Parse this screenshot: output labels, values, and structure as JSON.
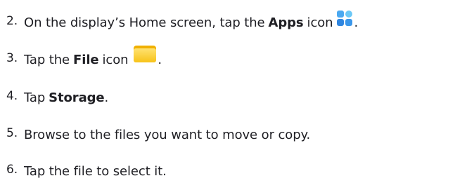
{
  "steps": [
    {
      "number": "2.",
      "before": "On the display’s Home screen, tap the",
      "bold": "Apps",
      "after": "icon",
      "icon": "apps-icon",
      "end": "."
    },
    {
      "number": "3.",
      "before": "Tap the",
      "bold": "File",
      "after": "icon",
      "icon": "folder-icon",
      "end": "."
    },
    {
      "number": "4.",
      "before": "Tap",
      "bold": "Storage",
      "end": "."
    },
    {
      "number": "5.",
      "text": "Browse to the files you want to move or copy."
    },
    {
      "number": "6.",
      "text": "Tap the file to select it."
    }
  ],
  "colors": {
    "text": "#1f1f24",
    "apps_icon": "#3b97ea",
    "folder_icon": "#f7c319"
  }
}
